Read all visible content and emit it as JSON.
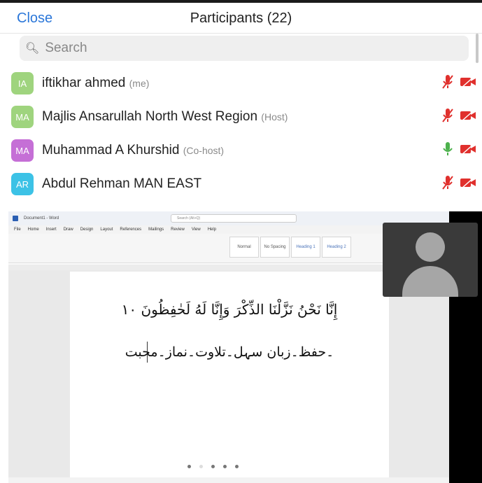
{
  "header": {
    "close_label": "Close",
    "title": "Participants (22)"
  },
  "search": {
    "placeholder": "Search"
  },
  "participants": [
    {
      "initials": "IA",
      "name": "iftikhar ahmed",
      "role": "(me)",
      "avatar_color": "#9fd47e",
      "mic": "muted",
      "video": "off"
    },
    {
      "initials": "MA",
      "name": "Majlis Ansarullah North West Region",
      "role": "(Host)",
      "avatar_color": "#9fd47e",
      "mic": "muted",
      "video": "off"
    },
    {
      "initials": "MA",
      "name": "Muhammad A Khurshid",
      "role": "(Co-host)",
      "avatar_color": "#c56fd6",
      "mic": "on",
      "video": "off"
    },
    {
      "initials": "AR",
      "name": "Abdul Rehman MAN EAST",
      "role": "",
      "avatar_color": "#3cc2e6",
      "mic": "muted",
      "video": "off"
    }
  ],
  "shared_screen": {
    "app_title": "Document1 - Word",
    "search_placeholder": "Search (Alt+Q)",
    "menu_tabs": [
      "File",
      "Home",
      "Insert",
      "Draw",
      "Design",
      "Layout",
      "References",
      "Mailings",
      "Review",
      "View",
      "Help"
    ],
    "styles": [
      "Normal",
      "No Spacing",
      "Heading 1",
      "Heading 2"
    ],
    "verse_line": "إِنَّا نَحْنُ نَزَّلْنَا الذِّكْرَ وَإِنَّا لَهُ لَحٰفِظُونَ ١٠",
    "text_line": "۔حفظ۔زبان سہل۔تلاوت۔نماز۔محبت",
    "page_dots": 5
  },
  "colors": {
    "accent": "#2b77d9",
    "mic_muted": "#e0302d",
    "mic_on": "#4cb14c",
    "video_off": "#e0302d"
  }
}
